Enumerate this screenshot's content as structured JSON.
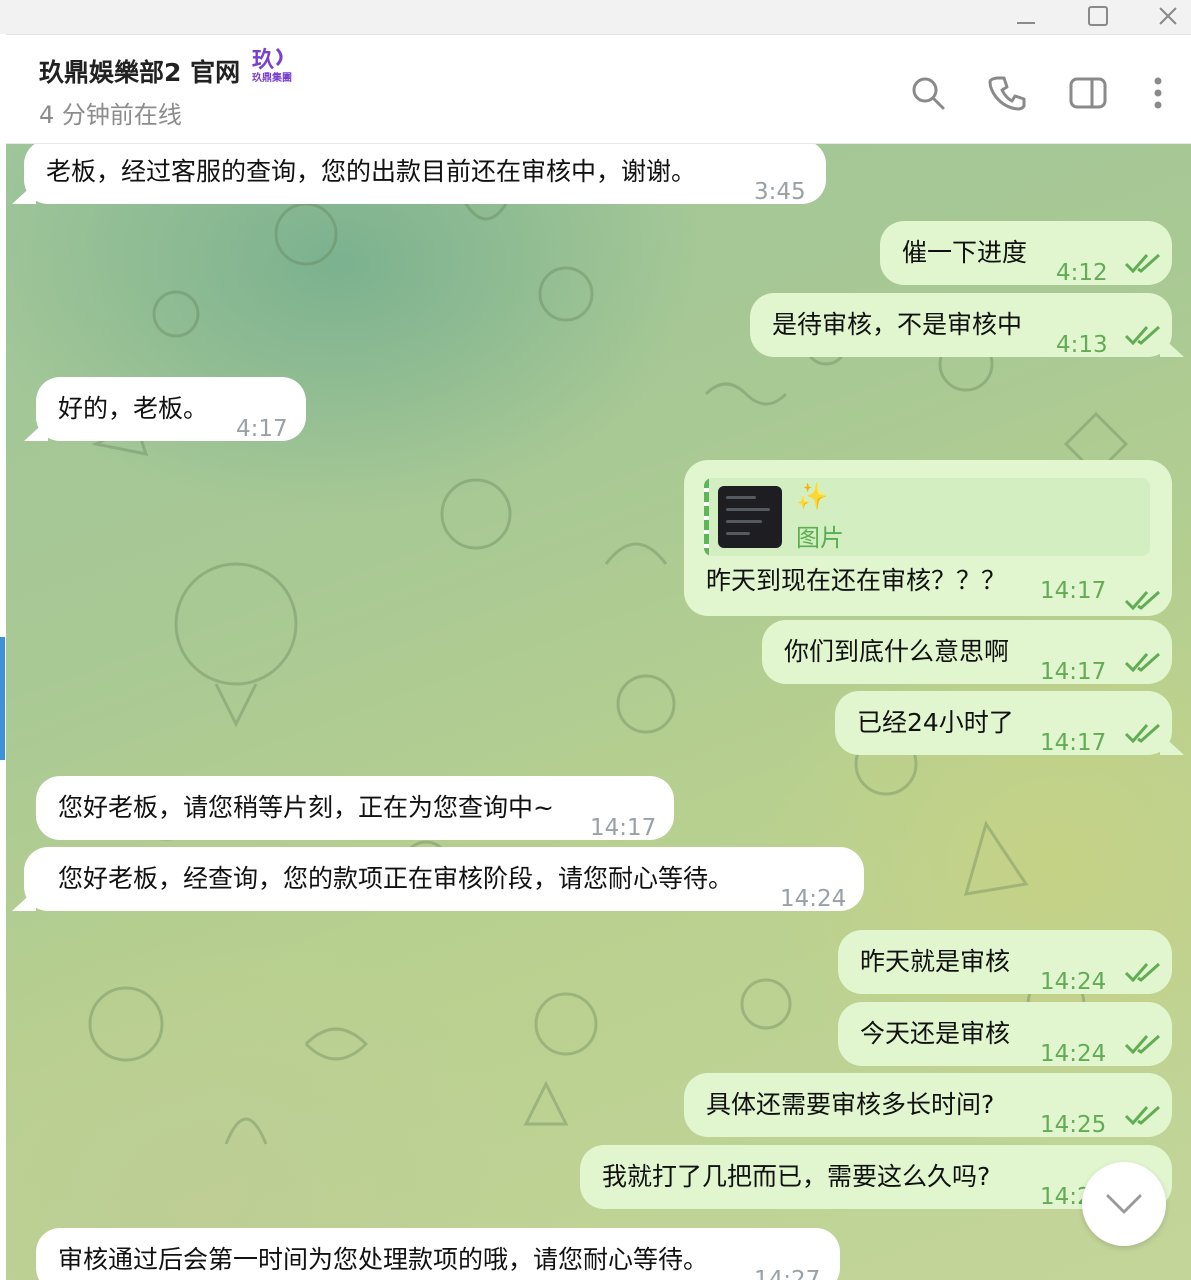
{
  "window": {
    "minimize_icon": "minimize-icon",
    "maximize_icon": "maximize-icon",
    "close_icon": "close-icon"
  },
  "header": {
    "title": "玖鼎娛樂部2 官网",
    "logo_text": "玖鼎集團",
    "status": "4 分钟前在线",
    "icons": [
      "search-icon",
      "phone-icon",
      "sidebar-icon",
      "more-icon"
    ]
  },
  "colors": {
    "incoming_bubble": "#ffffff",
    "outgoing_bubble": "#e1f6cf",
    "outgoing_time": "#62ac55",
    "incoming_time": "#9aa1a6",
    "accent_blue": "#3e90d9"
  },
  "messages": [
    {
      "dir": "in",
      "text": "老板，经过客服的查询，您的出款目前还在审核中，谢谢。",
      "time": "3:45"
    },
    {
      "dir": "out",
      "text": "催一下进度",
      "time": "4:12",
      "read": true
    },
    {
      "dir": "out",
      "text": "是待审核，不是审核中",
      "time": "4:13",
      "read": true
    },
    {
      "dir": "in",
      "text": "好的，老板。",
      "time": "4:17"
    },
    {
      "dir": "out",
      "reply_label": "图片",
      "text": "昨天到现在还在审核？？？",
      "time": "14:17",
      "read": true
    },
    {
      "dir": "out",
      "text": "你们到底什么意思啊",
      "time": "14:17",
      "read": true
    },
    {
      "dir": "out",
      "text": "已经24小时了",
      "time": "14:17",
      "read": true
    },
    {
      "dir": "in",
      "text": "您好老板，请您稍等片刻，正在为您查询中~",
      "time": "14:17"
    },
    {
      "dir": "in",
      "text": "您好老板，经查询，您的款项正在审核阶段，请您耐心等待。",
      "time": "14:24"
    },
    {
      "dir": "out",
      "text": "昨天就是审核",
      "time": "14:24",
      "read": true
    },
    {
      "dir": "out",
      "text": "今天还是审核",
      "time": "14:24",
      "read": true
    },
    {
      "dir": "out",
      "text": "具体还需要审核多长时间?",
      "time": "14:25",
      "read": true
    },
    {
      "dir": "out",
      "text": "我就打了几把而已，需要这么久吗?",
      "time": "14:2",
      "read": true
    },
    {
      "dir": "in",
      "text": "审核通过后会第一时间为您处理款项的哦，请您耐心等待。",
      "time": "14:27"
    }
  ],
  "scroll_down_icon": "chevron-down-icon"
}
